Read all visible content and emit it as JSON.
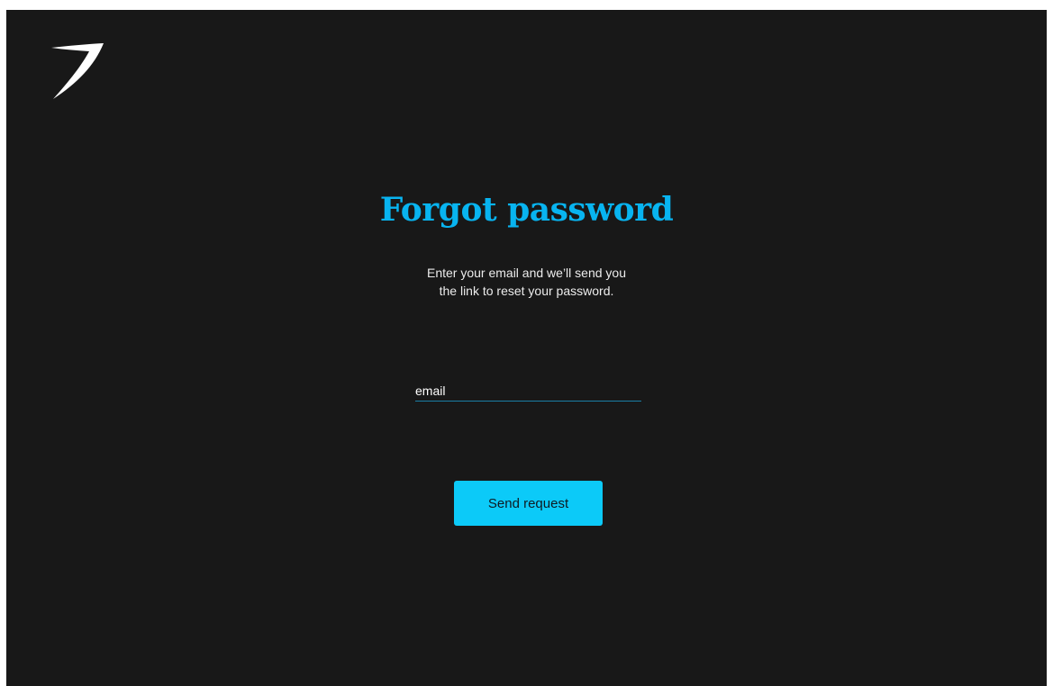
{
  "colors": {
    "background": "#181818",
    "accent": "#08b4f0",
    "button": "#0ccaf8",
    "underline": "#1a7fa5"
  },
  "header": {
    "logo_icon": "swoosh-logo-icon"
  },
  "main": {
    "title": "Forgot password",
    "subtitle_line1": "Enter your email and we’ll send you",
    "subtitle_line2": "the link to reset your password.",
    "email_placeholder": "email",
    "email_value": "",
    "submit_label": "Send request"
  }
}
